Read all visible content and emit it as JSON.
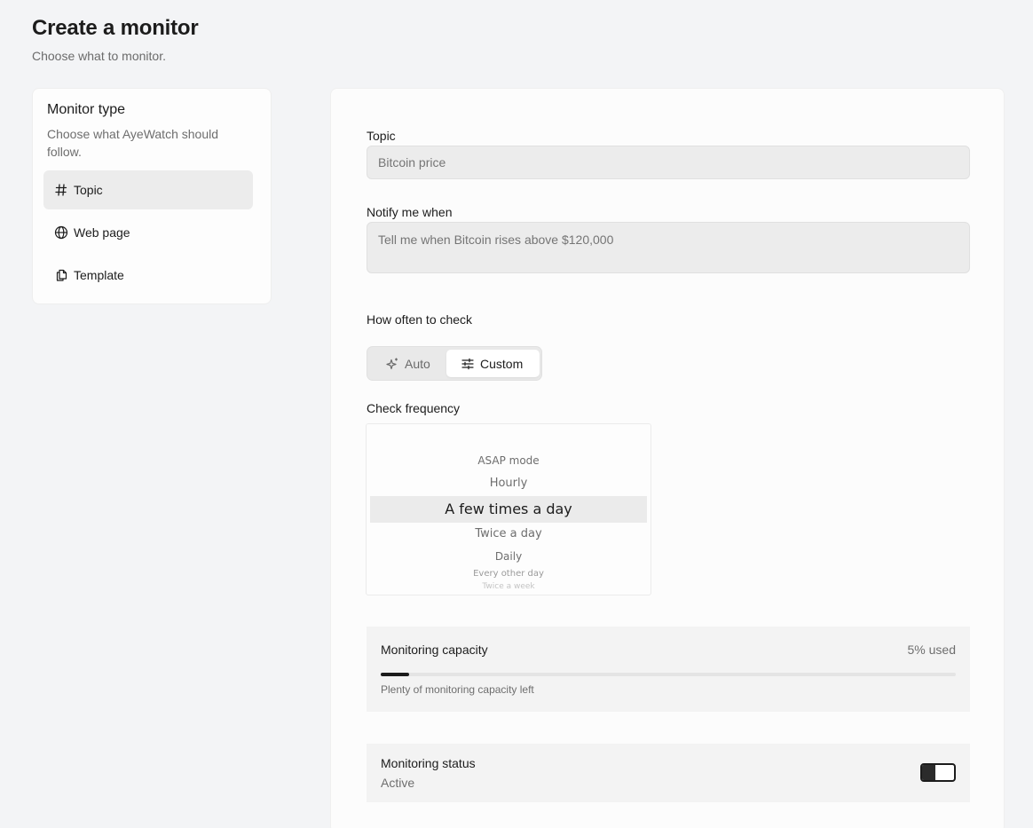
{
  "header": {
    "title": "Create a monitor",
    "subtitle": "Choose what to monitor."
  },
  "sidebar": {
    "title": "Monitor type",
    "description": "Choose what AyeWatch should follow.",
    "items": [
      {
        "label": "Topic",
        "icon": "hash-icon",
        "active": true
      },
      {
        "label": "Web page",
        "icon": "globe-icon",
        "active": false
      },
      {
        "label": "Template",
        "icon": "copy-icon",
        "active": false
      }
    ]
  },
  "form": {
    "topic_label": "Topic",
    "topic_placeholder": "Bitcoin price",
    "notify_label": "Notify me when",
    "notify_placeholder": "Tell me when Bitcoin rises above $120,000",
    "frequency_mode_label": "How often to check",
    "mode_auto": "Auto",
    "mode_custom": "Custom",
    "mode_selected": "Custom",
    "check_frequency_label": "Check frequency",
    "frequency_options": [
      "ASAP mode",
      "Hourly",
      "A few times a day",
      "Twice a day",
      "Daily",
      "Every other day",
      "Twice a week"
    ],
    "frequency_selected": "A few times a day"
  },
  "capacity": {
    "title": "Monitoring capacity",
    "used_text": "5% used",
    "used_fraction": 0.05,
    "note": "Plenty of monitoring capacity left"
  },
  "status": {
    "title": "Monitoring status",
    "value": "Active",
    "toggle_on": true
  },
  "colors": {
    "background": "#f3f4f6",
    "card": "#fcfcfc",
    "accent": "#1c1c1c",
    "input_bg": "#ececec"
  }
}
